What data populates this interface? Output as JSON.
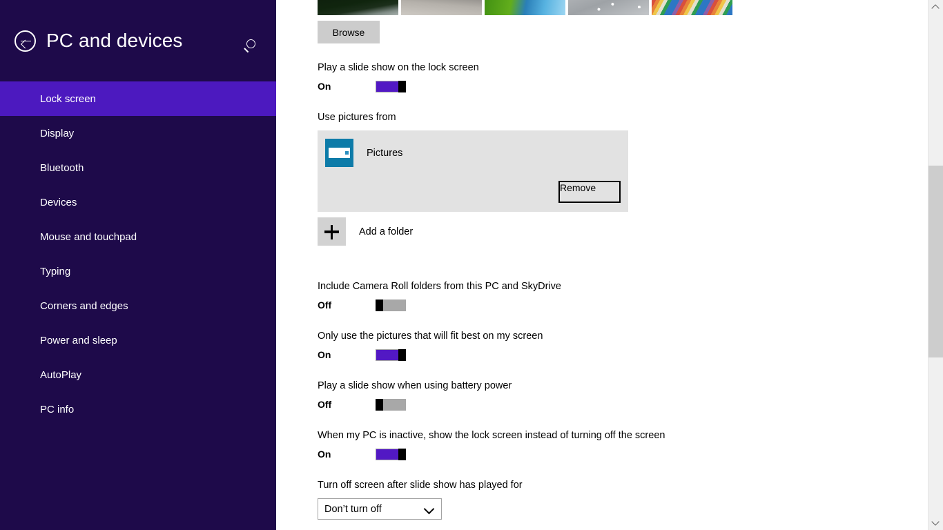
{
  "sidebar": {
    "title": "PC and devices",
    "back_icon": "back-arrow-icon",
    "search_icon": "search-icon",
    "items": [
      {
        "label": "Lock screen",
        "selected": true
      },
      {
        "label": "Display",
        "selected": false
      },
      {
        "label": "Bluetooth",
        "selected": false
      },
      {
        "label": "Devices",
        "selected": false
      },
      {
        "label": "Mouse and touchpad",
        "selected": false
      },
      {
        "label": "Typing",
        "selected": false
      },
      {
        "label": "Corners and edges",
        "selected": false
      },
      {
        "label": "Power and sleep",
        "selected": false
      },
      {
        "label": "AutoPlay",
        "selected": false
      },
      {
        "label": "PC info",
        "selected": false
      }
    ]
  },
  "colors": {
    "sidebar_bg": "#1e0a4a",
    "sidebar_selected": "#4c19bf",
    "accent_purple": "#5218c4",
    "toggle_off_track": "#a8a8a8",
    "toggle_thumb": "#000000",
    "button_gray": "#cccccc",
    "panel_gray": "#e2e2e2",
    "folder_icon_teal": "#0d7ba8"
  },
  "main": {
    "thumbnails": [
      {
        "name": "lock-screen-thumbnail-1",
        "description": "dark green foliage with path"
      },
      {
        "name": "lock-screen-thumbnail-2",
        "description": "gray concrete surface"
      },
      {
        "name": "lock-screen-thumbnail-3",
        "description": "green field and blue water"
      },
      {
        "name": "lock-screen-thumbnail-4",
        "description": "water droplets on gray surface"
      },
      {
        "name": "lock-screen-thumbnail-5",
        "description": "colorful diagonal stripes"
      }
    ],
    "browse_label": "Browse",
    "settings": {
      "slideshow": {
        "label": "Play a slide show on the lock screen",
        "state": "On",
        "value": true
      },
      "use_pictures_from": {
        "label": "Use pictures from",
        "folders": [
          {
            "name": "Pictures",
            "icon": "pictures-folder-icon",
            "remove_label": "Remove"
          }
        ],
        "add_folder_label": "Add a folder",
        "add_folder_icon": "plus-icon"
      },
      "camera_roll": {
        "label": "Include Camera Roll folders from this PC and SkyDrive",
        "state": "Off",
        "value": false
      },
      "fit_best": {
        "label": "Only use the pictures that will fit best on my screen",
        "state": "On",
        "value": true
      },
      "battery_power": {
        "label": "Play a slide show when using battery power",
        "state": "Off",
        "value": false
      },
      "inactive_lock": {
        "label": "When my PC is inactive, show the lock screen instead of turning off the screen",
        "state": "On",
        "value": true
      },
      "turn_off_screen": {
        "label": "Turn off screen after slide show has played for",
        "selected_option": "Don’t turn off",
        "chevron_icon": "chevron-down-icon"
      }
    }
  },
  "scrollbar": {
    "up_icon": "chevron-up-icon",
    "down_icon": "chevron-down-icon"
  }
}
